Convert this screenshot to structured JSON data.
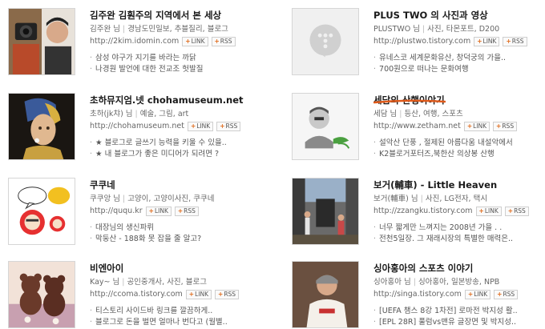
{
  "cards": [
    {
      "title": "김주완 김훤주의 지역에서 본 세상",
      "author": "김주완 님",
      "tags": [
        "경남도민일보",
        "추블질리",
        "블로그"
      ],
      "url": "http://2kim.idomin.com",
      "link_label": "LINK",
      "rss_label": "RSS",
      "posts": [
        "삼성 야구가 지기를 바라는 까닭",
        "나경원 발언에 대한 전교조 헛발질"
      ],
      "thumb_icon": "photographers-portrait-image"
    },
    {
      "title": "PLUS TWO 의 사진과 영상",
      "author": "PLUSTWO 님",
      "tags": [
        "사진",
        "타몬포트",
        "D200"
      ],
      "url": "http://plustwo.tistory.com",
      "link_label": "LINK",
      "rss_label": "RSS",
      "posts": [
        "유네스코 세계문화유산, 창덕궁의 가을..",
        "700원으로 떠나는 문화여행"
      ],
      "thumb_icon": "default-placeholder-icon"
    },
    {
      "title": "초하뮤지엄.넷 chohamuseum.net",
      "author": "초하(jk챠) 님",
      "tags": [
        "예술",
        "그림",
        "art"
      ],
      "url": "http://chohamuseum.net",
      "link_label": "LINK",
      "rss_label": "RSS",
      "posts": [
        "★ 블로그로 글쓰기 능력을 키울 수 있을..",
        "★ 내 블로그가 좋은 미디어가 되려면 ?"
      ],
      "thumb_icon": "pearl-earring-painting-image"
    },
    {
      "title": "세담의 산행이야기",
      "author": "세담 님",
      "tags": [
        "등산",
        "여행",
        "스포츠"
      ],
      "url": "http://www.zetham.net",
      "link_label": "LINK",
      "rss_label": "RSS",
      "posts": [
        "설악산 단풍 , 절제된 아름다움 내설악에서",
        "K2블로거포터즈,북한산 의상봉 산행"
      ],
      "thumb_icon": "hiker-portrait-image"
    },
    {
      "title": "쿠쿠네",
      "author": "쿠쿠앙 님",
      "tags": [
        "고양이",
        "고양이사진",
        "쿠쿠네"
      ],
      "url": "http://ququ.kr",
      "link_label": "LINK",
      "rss_label": "RSS",
      "posts": [
        "대장님의 생신파뤼",
        "막둥산 - 188화 못 잡을 줄 알고?"
      ],
      "thumb_icon": "cartoon-cat-image"
    },
    {
      "title": "보거(輔車) - Little Heaven",
      "author": "보거(輔車) 님",
      "tags": [
        "사진",
        "LG전자",
        "택시"
      ],
      "url": "http://zzangku.tistory.com",
      "link_label": "LINK",
      "rss_label": "RSS",
      "posts": [
        "너무 짧게만 느껴지는 2008년 가을 . .",
        "전천5일장. 그 재래시장의 특별한 매력은.."
      ],
      "thumb_icon": "street-photo-image"
    },
    {
      "title": "비엔아이",
      "author": "Kay~ 님",
      "tags": [
        "공인중개사",
        "사진",
        "블로그"
      ],
      "url": "http://ccoma.tistory.com",
      "link_label": "LINK",
      "rss_label": "RSS",
      "posts": [
        "티스토리 사이드바 링크를 깔끔하게..",
        "블로그로 돈을 벌면 얼마나 번다고 (월별.."
      ],
      "thumb_icon": "teddy-bears-image"
    },
    {
      "title": "싱아홍아의 스포츠 이야기",
      "author": "싱아홍아 님",
      "tags": [
        "싱아홍아",
        "일본방송",
        "NPB"
      ],
      "url": "http://singa.tistory.com",
      "link_label": "LINK",
      "rss_label": "RSS",
      "posts": [
        "[UEFA 챔스 8강 1차전] 로마전 박지성 활..",
        "[EPL 28R] 풀럼vs맨유 글장면 및 박지성.."
      ],
      "thumb_icon": "baseball-player-image"
    }
  ],
  "colors": {
    "highlight_underline": "#e05a1a",
    "link_plus": "#e06a1a"
  }
}
